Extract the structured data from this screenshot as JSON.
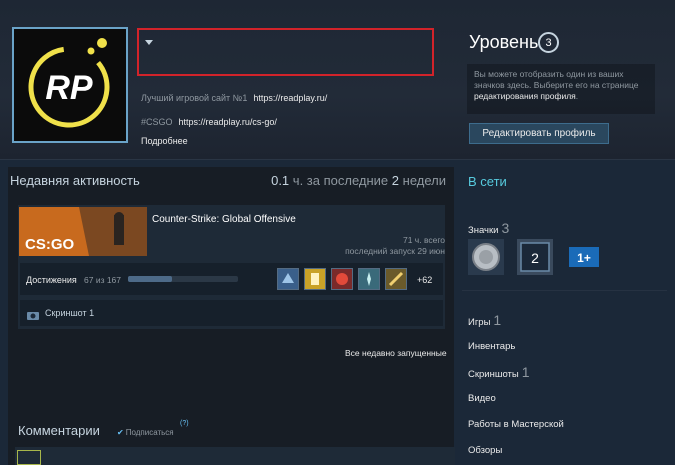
{
  "profile": {
    "info_label_1": "Лучший игровой сайт №1",
    "info_link_1": "https://readplay.ru/",
    "info_label_2": "#CSGO",
    "info_link_2": "https://readplay.ru/cs-go/",
    "more": "Подробнее",
    "avatar_text": "RP"
  },
  "level": {
    "title": "Уровень",
    "value": "3",
    "note_text": "Вы можете отобразить один из ваших значков здесь. Выберите его на странице ",
    "note_link": "редактирования профиля",
    "note_end": ".",
    "edit_button": "Редактировать профиль"
  },
  "activity": {
    "title": "Недавняя активность",
    "hours": "0.1",
    "hours_unit": "ч. за последние",
    "weeks": "2",
    "weeks_unit": "недели",
    "game": {
      "name": "Counter-Strike: Global Offensive",
      "total": "71 ч. всего",
      "last_launch": "последний запуск 29 июн",
      "cap_text": "CS:GO"
    },
    "achievements": {
      "label": "Достижения",
      "count": "67 из 167",
      "progress": 0.4,
      "more": "+62"
    },
    "screenshots": "Скриншот 1",
    "all_recent": "Все недавно запущенные"
  },
  "comments": {
    "title": "Комментарии",
    "subscribe": "Подписаться",
    "help": "(?)"
  },
  "sidebar": {
    "status": "В сети",
    "badges_label": "Значки",
    "badges_count": "3",
    "badge_2": "2",
    "badge_3": "1+",
    "games_label": "Игры",
    "games_count": "1",
    "inventory": "Инвентарь",
    "screenshots_label": "Скриншоты",
    "screenshots_count": "1",
    "videos": "Видео",
    "workshop": "Работы в Мастерской",
    "reviews": "Обзоры"
  },
  "colors": {
    "accent": "#57cbde",
    "highlight_box": "#d2232a",
    "background": "#1b2838"
  }
}
